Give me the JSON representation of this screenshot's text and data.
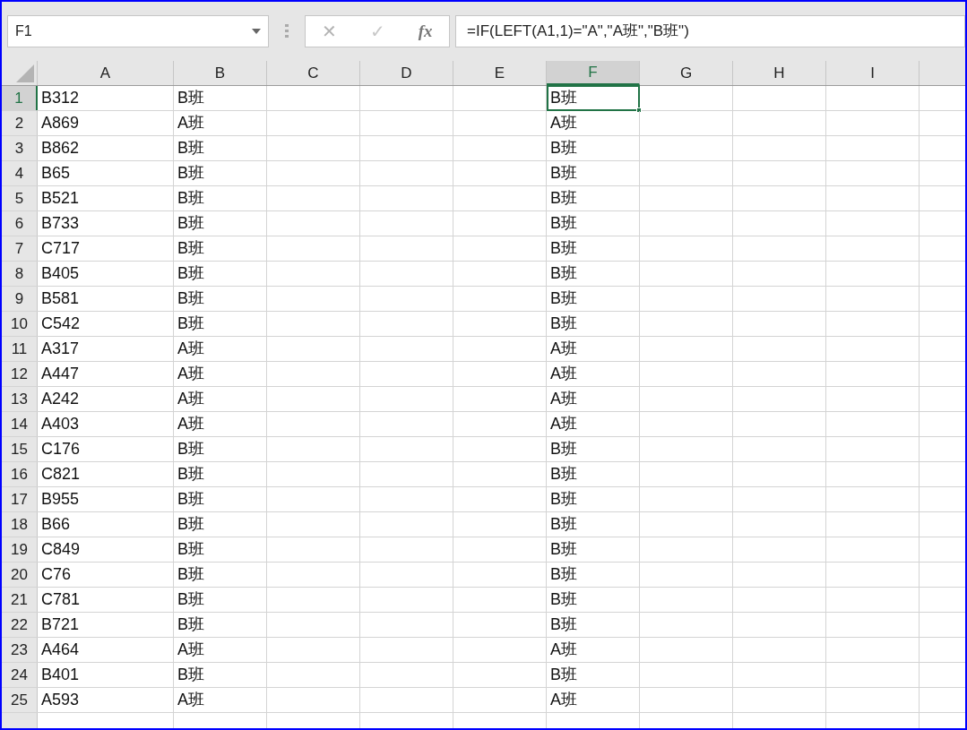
{
  "name_box": {
    "value": "F1"
  },
  "formula_bar": {
    "cancel": "✕",
    "enter": "✓",
    "function": "fx",
    "value": "=IF(LEFT(A1,1)=\"A\",\"A班\",\"B班\")"
  },
  "columns": [
    {
      "label": "A",
      "selected": false
    },
    {
      "label": "B",
      "selected": false
    },
    {
      "label": "C",
      "selected": false
    },
    {
      "label": "D",
      "selected": false
    },
    {
      "label": "E",
      "selected": false
    },
    {
      "label": "F",
      "selected": true
    },
    {
      "label": "G",
      "selected": false
    },
    {
      "label": "H",
      "selected": false
    },
    {
      "label": "I",
      "selected": false
    }
  ],
  "rows": [
    {
      "label": "1",
      "selected": true,
      "cells": [
        "B312",
        "B班",
        null,
        null,
        null,
        "B班",
        null,
        null,
        null
      ]
    },
    {
      "label": "2",
      "selected": false,
      "cells": [
        "A869",
        "A班",
        null,
        null,
        null,
        "A班",
        null,
        null,
        null
      ]
    },
    {
      "label": "3",
      "selected": false,
      "cells": [
        "B862",
        "B班",
        null,
        null,
        null,
        "B班",
        null,
        null,
        null
      ]
    },
    {
      "label": "4",
      "selected": false,
      "cells": [
        "B65",
        "B班",
        null,
        null,
        null,
        "B班",
        null,
        null,
        null
      ]
    },
    {
      "label": "5",
      "selected": false,
      "cells": [
        "B521",
        "B班",
        null,
        null,
        null,
        "B班",
        null,
        null,
        null
      ]
    },
    {
      "label": "6",
      "selected": false,
      "cells": [
        "B733",
        "B班",
        null,
        null,
        null,
        "B班",
        null,
        null,
        null
      ]
    },
    {
      "label": "7",
      "selected": false,
      "cells": [
        "C717",
        "B班",
        null,
        null,
        null,
        "B班",
        null,
        null,
        null
      ]
    },
    {
      "label": "8",
      "selected": false,
      "cells": [
        "B405",
        "B班",
        null,
        null,
        null,
        "B班",
        null,
        null,
        null
      ]
    },
    {
      "label": "9",
      "selected": false,
      "cells": [
        "B581",
        "B班",
        null,
        null,
        null,
        "B班",
        null,
        null,
        null
      ]
    },
    {
      "label": "10",
      "selected": false,
      "cells": [
        "C542",
        "B班",
        null,
        null,
        null,
        "B班",
        null,
        null,
        null
      ]
    },
    {
      "label": "11",
      "selected": false,
      "cells": [
        "A317",
        "A班",
        null,
        null,
        null,
        "A班",
        null,
        null,
        null
      ]
    },
    {
      "label": "12",
      "selected": false,
      "cells": [
        "A447",
        "A班",
        null,
        null,
        null,
        "A班",
        null,
        null,
        null
      ]
    },
    {
      "label": "13",
      "selected": false,
      "cells": [
        "A242",
        "A班",
        null,
        null,
        null,
        "A班",
        null,
        null,
        null
      ]
    },
    {
      "label": "14",
      "selected": false,
      "cells": [
        "A403",
        "A班",
        null,
        null,
        null,
        "A班",
        null,
        null,
        null
      ]
    },
    {
      "label": "15",
      "selected": false,
      "cells": [
        "C176",
        "B班",
        null,
        null,
        null,
        "B班",
        null,
        null,
        null
      ]
    },
    {
      "label": "16",
      "selected": false,
      "cells": [
        "C821",
        "B班",
        null,
        null,
        null,
        "B班",
        null,
        null,
        null
      ]
    },
    {
      "label": "17",
      "selected": false,
      "cells": [
        "B955",
        "B班",
        null,
        null,
        null,
        "B班",
        null,
        null,
        null
      ]
    },
    {
      "label": "18",
      "selected": false,
      "cells": [
        "B66",
        "B班",
        null,
        null,
        null,
        "B班",
        null,
        null,
        null
      ]
    },
    {
      "label": "19",
      "selected": false,
      "cells": [
        "C849",
        "B班",
        null,
        null,
        null,
        "B班",
        null,
        null,
        null
      ]
    },
    {
      "label": "20",
      "selected": false,
      "cells": [
        "C76",
        "B班",
        null,
        null,
        null,
        "B班",
        null,
        null,
        null
      ]
    },
    {
      "label": "21",
      "selected": false,
      "cells": [
        "C781",
        "B班",
        null,
        null,
        null,
        "B班",
        null,
        null,
        null
      ]
    },
    {
      "label": "22",
      "selected": false,
      "cells": [
        "B721",
        "B班",
        null,
        null,
        null,
        "B班",
        null,
        null,
        null
      ]
    },
    {
      "label": "23",
      "selected": false,
      "cells": [
        "A464",
        "A班",
        null,
        null,
        null,
        "A班",
        null,
        null,
        null
      ]
    },
    {
      "label": "24",
      "selected": false,
      "cells": [
        "B401",
        "B班",
        null,
        null,
        null,
        "B班",
        null,
        null,
        null
      ]
    },
    {
      "label": "25",
      "selected": false,
      "cells": [
        "A593",
        "A班",
        null,
        null,
        null,
        "A班",
        null,
        null,
        null
      ]
    }
  ]
}
